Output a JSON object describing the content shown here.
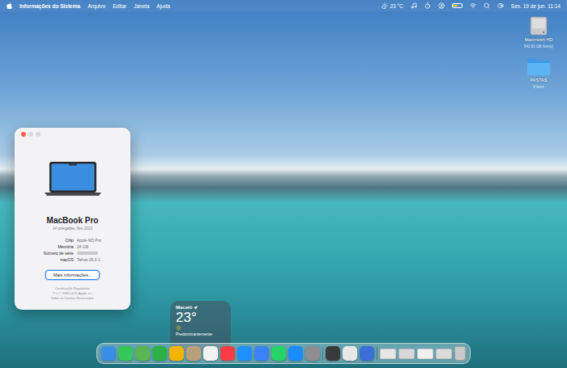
{
  "menu_bar": {
    "app_name": "Informações do Sistema",
    "menus": [
      "Arquivo",
      "Editar",
      "Janela",
      "Ajuda"
    ],
    "temperature": "23 °C",
    "date": "Sex. 19 de jun.",
    "time": "11:14",
    "battery_level": 0.6
  },
  "desktop_icons": [
    {
      "name": "Macintosh HD",
      "detail": "542,63 GB livre(s)",
      "kind": "drive"
    },
    {
      "name": "PASTAS",
      "detail": "6 itens",
      "kind": "folder"
    }
  ],
  "about_window": {
    "model": "MacBook Pro",
    "subtitle": "14 polegadas, Nov 2023",
    "specs": [
      {
        "label": "Chip",
        "value": "Apple M3 Pro",
        "redacted": false
      },
      {
        "label": "Memória",
        "value": "18 GB",
        "redacted": false
      },
      {
        "label": "Número de série",
        "redacted": true
      },
      {
        "label": "macOS",
        "value": "Tahoe 26.0.1",
        "redacted": false
      }
    ],
    "button": "Mais informações...",
    "footer": [
      "Certificação Regulatória",
      "™ e © 1983-2025 Apple Inc.",
      "Todos os Direitos Reservados."
    ]
  },
  "weather_widget": {
    "city": "Maceió",
    "temperature": "23°",
    "condition": "Predominantemente"
  },
  "dock": {
    "items": [
      {
        "kind": "app",
        "color": "#3a8ee6"
      },
      {
        "kind": "app",
        "color": "#34c759"
      },
      {
        "kind": "app",
        "color": "#5ab552"
      },
      {
        "kind": "app",
        "color": "#2fb14a"
      },
      {
        "kind": "app",
        "color": "#f4b400"
      },
      {
        "kind": "app",
        "color": "#b8a07a"
      },
      {
        "kind": "app",
        "color": "#f2f2f2"
      },
      {
        "kind": "app",
        "color": "#fc3c44"
      },
      {
        "kind": "app",
        "color": "#1e90ff"
      },
      {
        "kind": "app",
        "color": "#3b82f6"
      },
      {
        "kind": "app",
        "color": "#25d366"
      },
      {
        "kind": "app",
        "color": "#1a8cff"
      },
      {
        "kind": "app",
        "color": "#8e8e93"
      },
      {
        "kind": "separator"
      },
      {
        "kind": "app",
        "color": "#3a3a3c"
      },
      {
        "kind": "app",
        "color": "#e8e8e8"
      },
      {
        "kind": "app",
        "color": "#3b6fd8"
      },
      {
        "kind": "separator"
      },
      {
        "kind": "thumbnail",
        "color": "#e6e6e6"
      },
      {
        "kind": "thumbnail",
        "color": "#d8d8d8"
      },
      {
        "kind": "thumbnail",
        "color": "#f0f0f0"
      },
      {
        "kind": "thumbnail",
        "color": "#dcdcdc"
      },
      {
        "kind": "trash",
        "color": "#c9c9c9"
      }
    ]
  }
}
